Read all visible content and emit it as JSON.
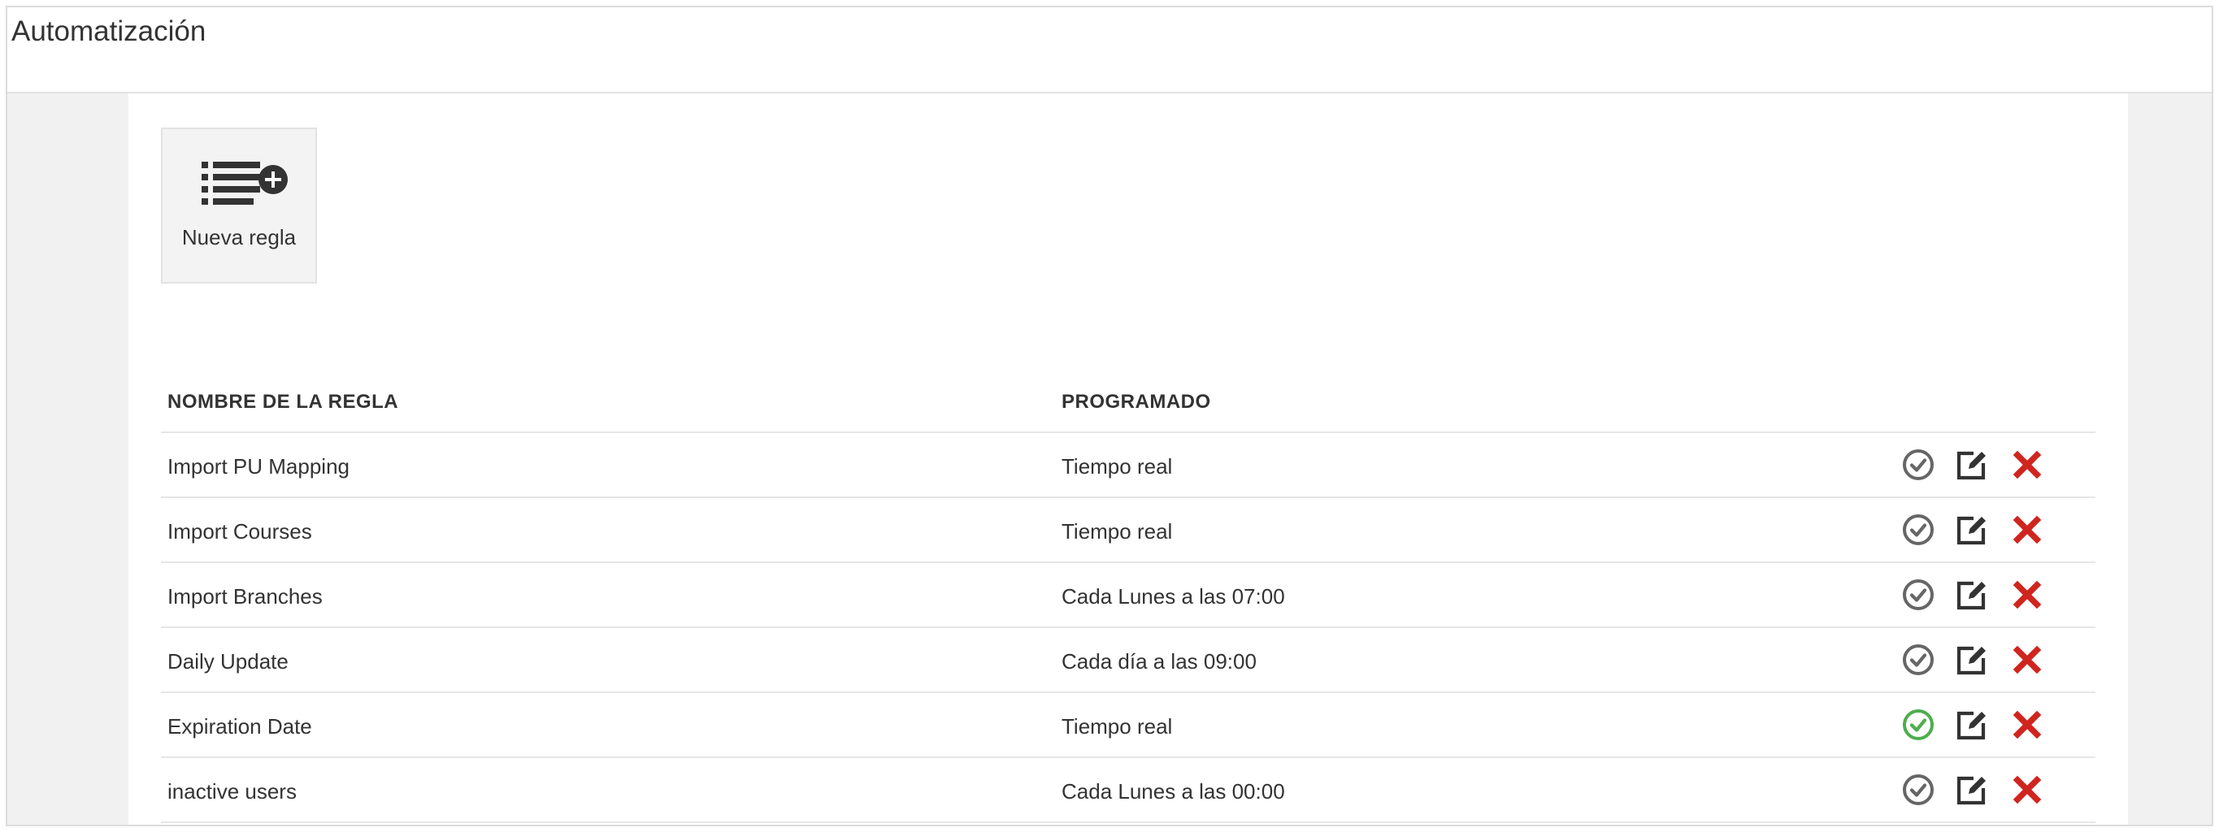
{
  "header": {
    "title": "Automatización"
  },
  "toolbar": {
    "new_rule_label": "Nueva regla",
    "new_rule_icon": "list-add-icon"
  },
  "table": {
    "columns": [
      "NOMBRE DE LA REGLA",
      "PROGRAMADO"
    ],
    "rows": [
      {
        "name": "Import PU Mapping",
        "schedule": "Tiempo real",
        "active": false
      },
      {
        "name": "Import Courses",
        "schedule": "Tiempo real",
        "active": false
      },
      {
        "name": "Import Branches",
        "schedule": "Cada Lunes a las 07:00",
        "active": false
      },
      {
        "name": "Daily Update",
        "schedule": "Cada día a las 09:00",
        "active": false
      },
      {
        "name": "Expiration Date",
        "schedule": "Tiempo real",
        "active": true
      },
      {
        "name": "inactive users",
        "schedule": "Cada Lunes a las 00:00",
        "active": false
      }
    ],
    "row_actions": [
      "check-circle-icon",
      "edit-icon",
      "delete-icon"
    ]
  },
  "colors": {
    "inactive_status": "#666666",
    "active_status": "#4cae4c",
    "delete": "#d0251f",
    "icon_dark": "#333333"
  }
}
